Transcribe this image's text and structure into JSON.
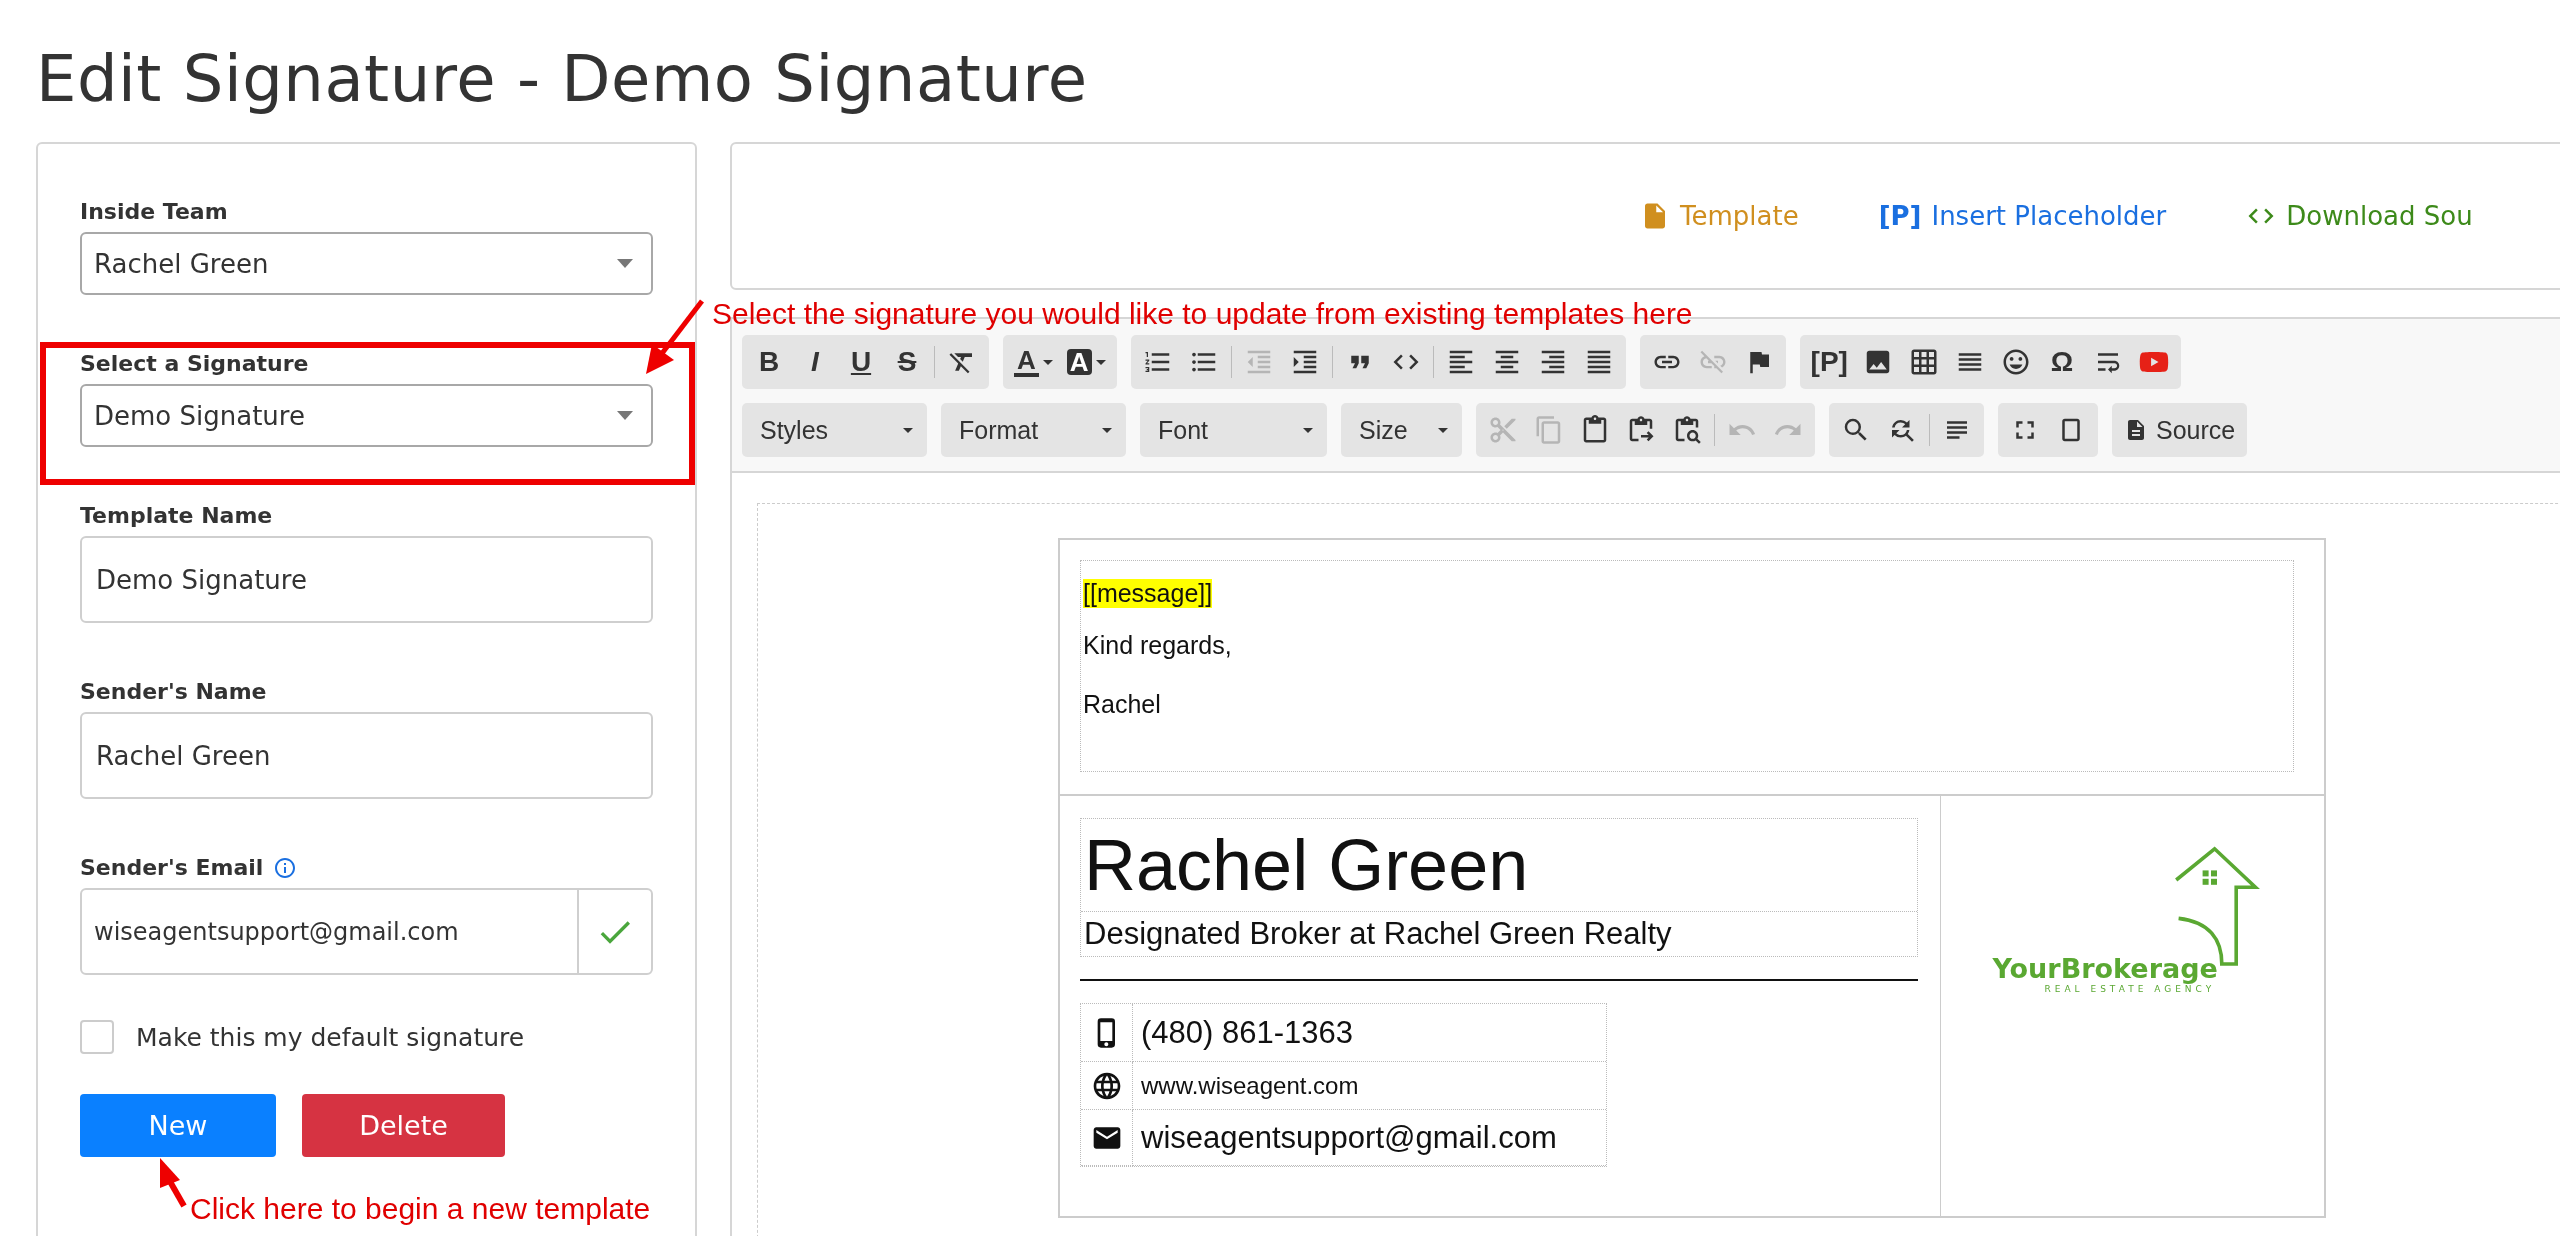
{
  "page_title": "Edit Signature - Demo Signature",
  "settings": {
    "team": {
      "label": "Inside Team",
      "value": "Rachel Green"
    },
    "signature": {
      "label": "Select a Signature",
      "value": "Demo Signature"
    },
    "template_name": {
      "label": "Template Name",
      "value": "Demo Signature"
    },
    "sender_name": {
      "label": "Sender's Name",
      "value": "Rachel Green"
    },
    "sender_email": {
      "label": "Sender's Email",
      "value": "wiseagentsupport@gmail.com",
      "verified": true
    },
    "default_checkbox": {
      "label": "Make this my default signature",
      "checked": false
    },
    "buttons": [
      {
        "label": "New",
        "kind": "primary"
      },
      {
        "label": "Delete",
        "kind": "danger"
      }
    ]
  },
  "editor_links": [
    {
      "kind": "template",
      "label": "Template",
      "color": "#d08f1f"
    },
    {
      "kind": "placeholder",
      "glyph": "[P]",
      "label": "Insert Placeholder",
      "color": "#1a6fe0"
    },
    {
      "kind": "source",
      "label": "Download Sou",
      "color": "#3d8a1a"
    }
  ],
  "toolbar": {
    "rows": [
      [
        [
          {
            "kind": "bold",
            "label": "B"
          },
          {
            "kind": "italic",
            "label": "I"
          },
          {
            "kind": "underline",
            "label": "U"
          },
          {
            "kind": "strike",
            "label": "S"
          },
          {
            "kind": "separator"
          },
          {
            "kind": "icon",
            "disabled": false
          }
        ],
        [
          {
            "kind": "color-text",
            "label": "A"
          },
          {
            "kind": "color-bg",
            "label": "A"
          }
        ],
        [
          {
            "kind": "icon",
            "disabled": false
          },
          {
            "kind": "icon",
            "disabled": false
          },
          {
            "kind": "separator"
          },
          {
            "kind": "icon",
            "disabled": true
          },
          {
            "kind": "icon",
            "disabled": false
          },
          {
            "kind": "separator"
          },
          {
            "kind": "icon",
            "disabled": false
          },
          {
            "kind": "icon",
            "disabled": false
          },
          {
            "kind": "separator"
          },
          {
            "kind": "icon",
            "disabled": false
          },
          {
            "kind": "icon",
            "disabled": false
          },
          {
            "kind": "icon",
            "disabled": false
          },
          {
            "kind": "icon",
            "disabled": false
          }
        ],
        [
          {
            "kind": "icon",
            "disabled": false
          },
          {
            "kind": "icon",
            "disabled": true
          },
          {
            "kind": "icon",
            "disabled": false
          }
        ],
        [
          {
            "kind": "glyph",
            "label": "[P]"
          },
          {
            "kind": "icon",
            "disabled": false
          },
          {
            "kind": "icon",
            "disabled": false
          },
          {
            "kind": "icon",
            "disabled": false
          },
          {
            "kind": "icon",
            "disabled": false
          },
          {
            "kind": "glyph",
            "label": "Ω"
          },
          {
            "kind": "icon",
            "disabled": false
          },
          {
            "kind": "icon",
            "disabled": false
          }
        ]
      ],
      [
        [
          {
            "kind": "dropdown",
            "label": "Styles"
          }
        ],
        [
          {
            "kind": "dropdown",
            "label": "Format"
          }
        ],
        [
          {
            "kind": "dropdown",
            "label": "Font"
          }
        ],
        [
          {
            "kind": "dropdown",
            "label": "Size"
          }
        ],
        [
          {
            "kind": "icon",
            "disabled": true
          },
          {
            "kind": "icon",
            "disabled": true
          },
          {
            "kind": "icon",
            "disabled": false
          },
          {
            "kind": "icon",
            "disabled": false
          },
          {
            "kind": "icon",
            "disabled": false
          },
          {
            "kind": "separator"
          },
          {
            "kind": "icon",
            "disabled": true
          },
          {
            "kind": "icon",
            "disabled": true
          }
        ],
        [
          {
            "kind": "icon",
            "disabled": false
          },
          {
            "kind": "icon",
            "disabled": false
          },
          {
            "kind": "separator"
          },
          {
            "kind": "icon",
            "disabled": false
          }
        ],
        [
          {
            "kind": "icon",
            "disabled": false
          },
          {
            "kind": "icon",
            "disabled": false
          }
        ],
        [
          {
            "kind": "source",
            "label": "Source"
          }
        ]
      ]
    ]
  },
  "document": {
    "message": {
      "merge_tag": "[[message]]",
      "lines": [
        "Kind regards,",
        "Rachel"
      ]
    },
    "card": {
      "name": "Rachel Green",
      "title": "Designated Broker at Rachel Green Realty",
      "contacts": [
        {
          "kind": "phone",
          "text": "(480) 861-1363"
        },
        {
          "kind": "web",
          "text": "www.wiseagent.com"
        },
        {
          "kind": "email",
          "text": "wiseagentsupport@gmail.com"
        }
      ],
      "logo": {
        "name": "YourBrokerage",
        "tagline": "REAL ESTATE AGENCY"
      }
    }
  },
  "annotations": [
    {
      "kind": "signature-callout",
      "text": "Select the signature you would like to update from existing templates here"
    },
    {
      "kind": "new-callout",
      "text": "Click here to begin a new template"
    }
  ]
}
